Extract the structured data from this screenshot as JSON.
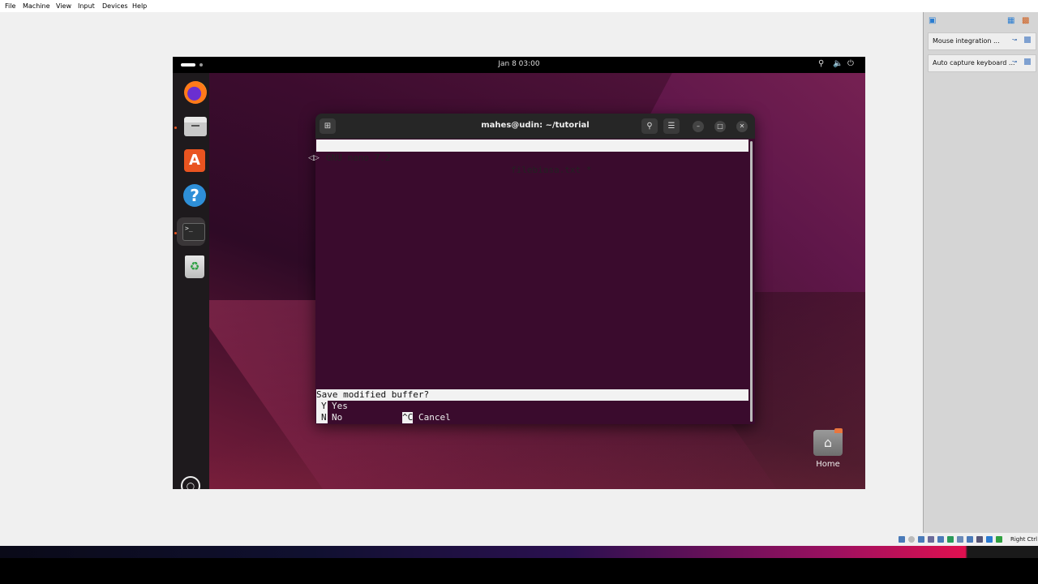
{
  "host": {
    "menu": [
      "File",
      "Machine",
      "View",
      "Input",
      "Devices",
      "Help"
    ],
    "side_panel": {
      "rows": [
        {
          "label": "Mouse integration ..."
        },
        {
          "label": "Auto capture keyboard ..."
        }
      ]
    },
    "status_host_key": "Right Ctrl"
  },
  "guest": {
    "top_bar": {
      "clock": "Jan 8  03:00"
    },
    "dock": [
      "firefox",
      "files",
      "app-center",
      "help",
      "terminal",
      "trash"
    ],
    "desktop": {
      "home_label": "Home"
    }
  },
  "terminal": {
    "title": "mahes@udin: ~/tutorial",
    "nano": {
      "version": "GNU nano 7.2",
      "filename": "filebiasa.txt *",
      "prompt": "Save modified buffer?",
      "options": [
        {
          "key": "Y",
          "label": "Yes"
        },
        {
          "key": "N",
          "label": "No"
        }
      ],
      "cancel_key": "^C",
      "cancel_label": "Cancel"
    }
  }
}
